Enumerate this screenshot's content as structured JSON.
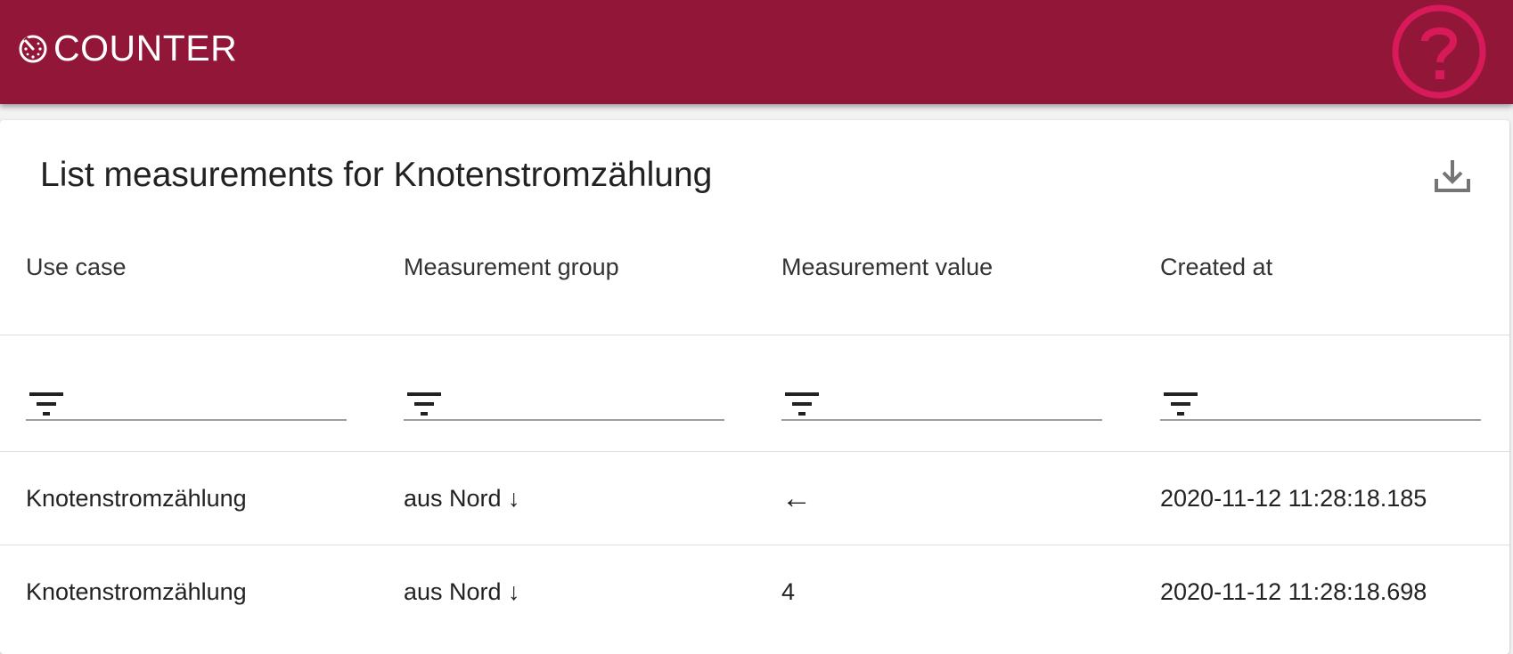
{
  "app": {
    "title": "COUNTER",
    "header_color": "#921638",
    "help_icon_color": "#d91a5a",
    "brand_icon": "timer-icon",
    "help_icon": "help-circle-icon"
  },
  "page": {
    "title": "List measurements for Knotenstromzählung",
    "download_icon": "download-icon"
  },
  "table": {
    "columns": [
      "Use case",
      "Measurement group",
      "Measurement value",
      "Created at"
    ],
    "filter_icon": "filter-icon",
    "filters": [
      "",
      "",
      "",
      ""
    ],
    "rows": [
      {
        "use_case": "Knotenstromzählung",
        "group": "aus Nord ↓",
        "value": "←",
        "created_at": "2020-11-12 11:28:18.185"
      },
      {
        "use_case": "Knotenstromzählung",
        "group": "aus Nord ↓",
        "value": "4",
        "created_at": "2020-11-12 11:28:18.698"
      }
    ]
  }
}
